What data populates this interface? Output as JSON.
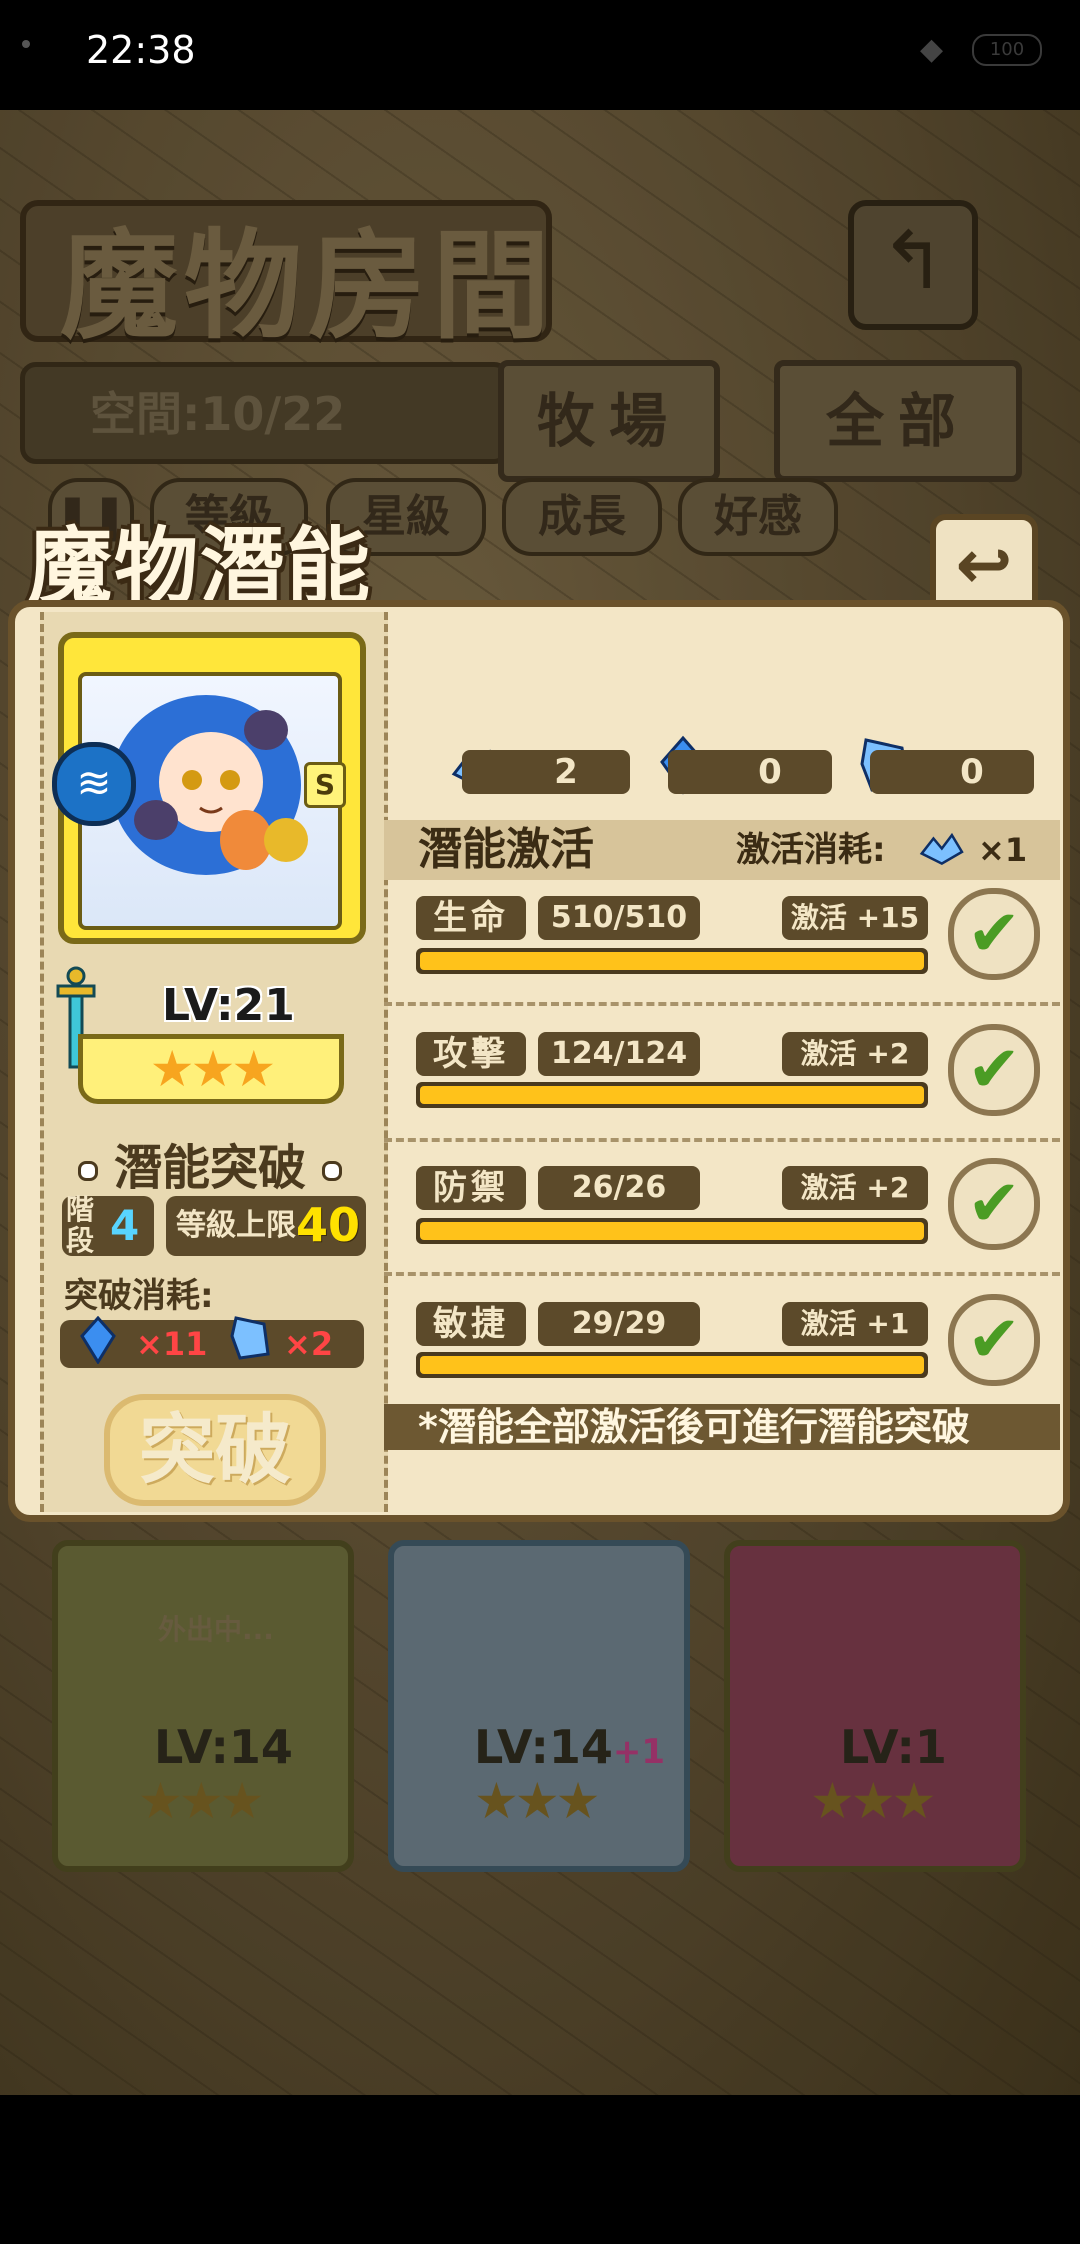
{
  "status_bar": {
    "time": "22:38",
    "battery": "100"
  },
  "background": {
    "title": "魔物房間",
    "space_label": "空間:10/22",
    "tabs": [
      {
        "label": "牧場"
      },
      {
        "label": "全部"
      }
    ],
    "filters": [
      {
        "label": "等級"
      },
      {
        "label": "星級"
      },
      {
        "label": "成長"
      },
      {
        "label": "好感"
      }
    ],
    "cards": [
      {
        "level": "LV:14",
        "status": "外出中...",
        "stars": "★★★"
      },
      {
        "level": "LV:14",
        "bonus": "+1",
        "stars": "★★★"
      },
      {
        "level": "LV:1",
        "stars": "★★★"
      }
    ]
  },
  "panel": {
    "title": "魔物潛能",
    "monster": {
      "rank": "S",
      "level": "LV:21",
      "stars": "★★★",
      "element_icon": "water-icon"
    },
    "breakthrough": {
      "title": "潛能突破",
      "stage_label": "階段",
      "stage_value": "4",
      "level_cap_label": "等級上限",
      "level_cap_value": "40",
      "cost_label": "突破消耗:",
      "cost_items": [
        {
          "icon": "blue-crystal-icon",
          "qty": "×11"
        },
        {
          "icon": "ice-crystal-icon",
          "qty": "×2"
        }
      ],
      "button_label": "突破"
    },
    "resources": [
      {
        "icon": "crystal-cluster-icon",
        "value": "2"
      },
      {
        "icon": "blue-crystal-icon",
        "value": "0"
      },
      {
        "icon": "ice-crystal-icon",
        "value": "0"
      }
    ],
    "activation": {
      "title": "潛能激活",
      "cost_label": "激活消耗:",
      "cost_qty": "×1",
      "stats": [
        {
          "name": "生命",
          "value": "510/510",
          "bonus": "激活 +15",
          "progress": 1.0
        },
        {
          "name": "攻擊",
          "value": "124/124",
          "bonus": "激活 +2",
          "progress": 1.0
        },
        {
          "name": "防禦",
          "value": "26/26",
          "bonus": "激活 +2",
          "progress": 1.0
        },
        {
          "name": "敏捷",
          "value": "29/29",
          "bonus": "激活 +1",
          "progress": 1.0
        }
      ],
      "note": "*潛能全部激活後可進行潛能突破"
    }
  },
  "colors": {
    "accent_yellow": "#ffc21a",
    "check_green": "#4b9c24",
    "panel_bg": "#f3e6c6"
  }
}
